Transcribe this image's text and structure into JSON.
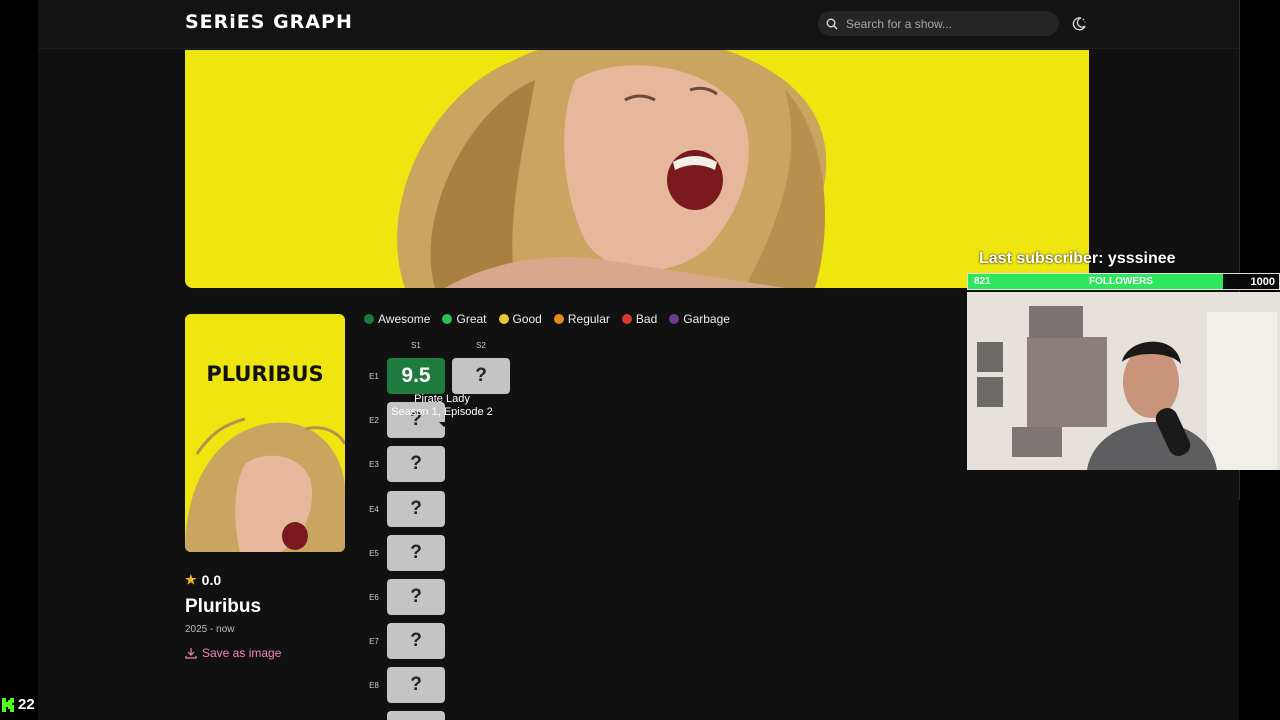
{
  "header": {
    "logo": "SERiES GRAPH",
    "search_placeholder": "Search for a show...",
    "theme_icon": "moon-icon"
  },
  "show": {
    "poster_title": "PLURIBUS",
    "rating": "0.0",
    "title": "Pluribus",
    "years": "2025 - now",
    "save_label": "Save as image"
  },
  "legend": [
    {
      "label": "Awesome",
      "color": "#1f7a3d"
    },
    {
      "label": "Great",
      "color": "#2fbf57"
    },
    {
      "label": "Good",
      "color": "#e8c93a"
    },
    {
      "label": "Regular",
      "color": "#e48a1f"
    },
    {
      "label": "Bad",
      "color": "#d63b32"
    },
    {
      "label": "Garbage",
      "color": "#6b3a8c"
    }
  ],
  "grid": {
    "seasons": [
      "S1",
      "S2"
    ],
    "episodes": [
      "E1",
      "E2",
      "E3",
      "E4",
      "E5",
      "E6",
      "E7",
      "E8"
    ],
    "cells": {
      "s1e1": "9.5",
      "s2e1": "?",
      "s1e2": "?",
      "s1e3": "?",
      "s1e4": "?",
      "s1e5": "?",
      "s1e6": "?",
      "s1e7": "?",
      "s1e8": "?"
    },
    "tooltip": {
      "title": "Pirate Lady",
      "subtitle": "Season 1, Episode 2"
    }
  },
  "overlay": {
    "last_subscriber": "Last subscriber: ysssinee",
    "followers_count": "821",
    "followers_label": "FOLLOWERS",
    "followers_goal": "1000",
    "followers_progress": 0.821,
    "kick_viewers": "22"
  }
}
